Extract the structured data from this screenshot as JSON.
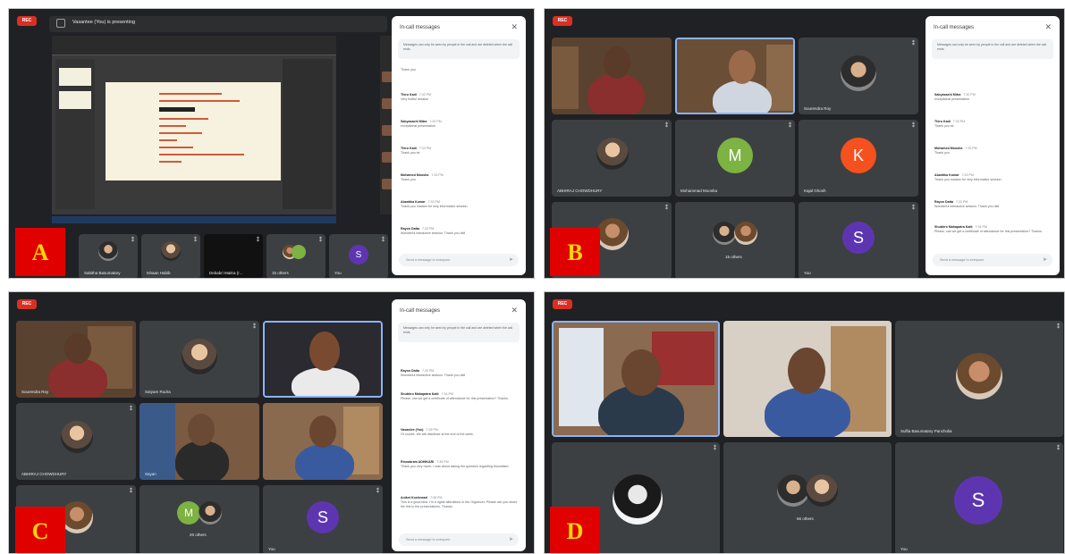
{
  "panels": {
    "a": {
      "label": "A",
      "rec": "REC",
      "presenting_text": "Vasantee (You) is presenting",
      "chat": {
        "title": "In-call messages",
        "notice": "Messages can only be seen by people in the call and are deleted when the call ends",
        "messages": [
          {
            "who": "",
            "when": "",
            "text": "Thank you"
          },
          {
            "who": "Thiru Kadi",
            "when": "7:32 PM",
            "text": "Very fruitful session"
          },
          {
            "who": "Sabyasachi Mitra",
            "when": "7:32 PM",
            "text": "exceptional presentation"
          },
          {
            "who": "Thiru Kadi",
            "when": "7:33 PM",
            "text": "Thank you sir"
          },
          {
            "who": "Mohamed Moosha",
            "when": "7:33 PM",
            "text": "Thank you"
          },
          {
            "who": "Abantika Kumar",
            "when": "7:33 PM",
            "text": "Thank you madam for very informative session."
          },
          {
            "who": "Rayon Datta",
            "when": "7:33 PM",
            "text": "Wonderful interactive session. Thank you didi"
          }
        ],
        "input_placeholder": "Send a message to everyone"
      },
      "tiles": [
        {
          "name": "Sabitha Basumatary"
        },
        {
          "name": "Ishaan Habib"
        },
        {
          "name": "Debabri Maitra (r..."
        },
        {
          "name": "15 others"
        },
        {
          "name": "You",
          "initial": "S"
        }
      ]
    },
    "b": {
      "label": "B",
      "rec": "REC",
      "chat": {
        "title": "In-call messages",
        "notice": "Messages can only be seen by people in the call and are deleted when the call ends",
        "messages": [
          {
            "who": "Sabyasachi Mitra",
            "when": "7:32 PM",
            "text": "exceptional presentation"
          },
          {
            "who": "Thiru Kadi",
            "when": "7:33 PM",
            "text": "Thank you sir"
          },
          {
            "who": "Mohamed Moosha",
            "when": "7:33 PM",
            "text": "Thank you"
          },
          {
            "who": "Abantika Kumar",
            "when": "7:33 PM",
            "text": "Thank you madam for very informative session."
          },
          {
            "who": "Rayon Datta",
            "when": "7:33 PM",
            "text": "Wonderful interactive session. Thank you didi"
          },
          {
            "who": "Shubhro Mahapatra Kaiti",
            "when": "7:34 PM",
            "text": "Please, can we get a certificate of attendance for this presentation? Thanks."
          }
        ],
        "input_placeholder": "Send a message to everyone"
      },
      "tiles": [
        {
          "name": ""
        },
        {
          "name": ""
        },
        {
          "name": "Sourendra Roy"
        },
        {
          "name": "ABHIRAJ CHOWDHURY"
        },
        {
          "name": "Mohammad Moosha",
          "initial": "M",
          "color": "#7cb342"
        },
        {
          "name": "Kajal Ghosh",
          "initial": "K",
          "color": "#f4511e"
        },
        {
          "name": ""
        },
        {
          "name": "15 others"
        },
        {
          "name": "You",
          "initial": "S",
          "color": "#5e35b1"
        }
      ]
    },
    "c": {
      "label": "C",
      "rec": "REC",
      "chat": {
        "title": "In-call messages",
        "notice": "Messages can only be seen by people in the call and are deleted when the call ends",
        "messages": [
          {
            "who": "Rayon Datta",
            "when": "7:33 PM",
            "text": "Wonderful interactive session. Thank you didi"
          },
          {
            "who": "Shubhro Mahapatra Kaiti",
            "when": "7:34 PM",
            "text": "Please, can we get a certificate of attendance for this presentation? Thanks."
          },
          {
            "who": "Vasantee (You)",
            "when": "7:35 PM",
            "text": "Of course. We will distribute at the end of the week."
          },
          {
            "who": "Rinnabram ADHIKARI",
            "when": "7:35 PM",
            "text": "Thank you very much. I was about asking the question regarding Mountlaim."
          },
          {
            "who": "Aniket Koshewari",
            "when": "7:36 PM",
            "text": "This is a good idea. I'm a rights alterations to the Organizer. Please can you share the link to the presentations. Thanks."
          }
        ],
        "input_placeholder": "Send a message to everyone"
      },
      "tiles": [
        {
          "name": "Sourendra Roy"
        },
        {
          "name": "Satyam Rudra"
        },
        {
          "name": ""
        },
        {
          "name": "ABHIRAJ CHOWDHURY"
        },
        {
          "name": "Sayan"
        },
        {
          "name": ""
        },
        {
          "name": ""
        },
        {
          "name": "26 others",
          "initial": "M",
          "color": "#7cb342"
        },
        {
          "name": "You",
          "initial": "S",
          "color": "#5e35b1"
        }
      ]
    },
    "d": {
      "label": "D",
      "rec": "REC",
      "tiles": [
        {
          "name": ""
        },
        {
          "name": ""
        },
        {
          "name": "Sulfia Basumatary Pancholia"
        },
        {
          "name": ""
        },
        {
          "name": "56 others"
        },
        {
          "name": "You",
          "initial": "S",
          "color": "#5e35b1"
        }
      ]
    }
  }
}
